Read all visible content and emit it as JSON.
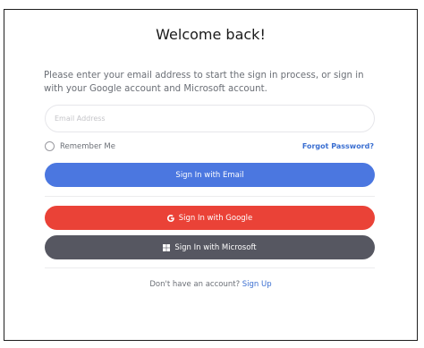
{
  "title": "Welcome back!",
  "description": "Please enter your email address to start the sign in process, or sign in with your Google account and Microsoft account.",
  "email": {
    "placeholder": "Email Address",
    "value": ""
  },
  "remember_label": "Remember Me",
  "forgot_label": "Forgot Password?",
  "buttons": {
    "email": "Sign In with Email",
    "google": "Sign In with Google",
    "microsoft": "Sign In with Microsoft"
  },
  "footer": {
    "prompt": "Don't have an account?",
    "link": "Sign Up"
  },
  "colors": {
    "primary": "#4b77e0",
    "google": "#ea4237",
    "microsoft": "#565761",
    "link": "#3b6fd1"
  },
  "icons": {
    "google": "google-g-icon",
    "microsoft": "windows-logo-icon"
  }
}
